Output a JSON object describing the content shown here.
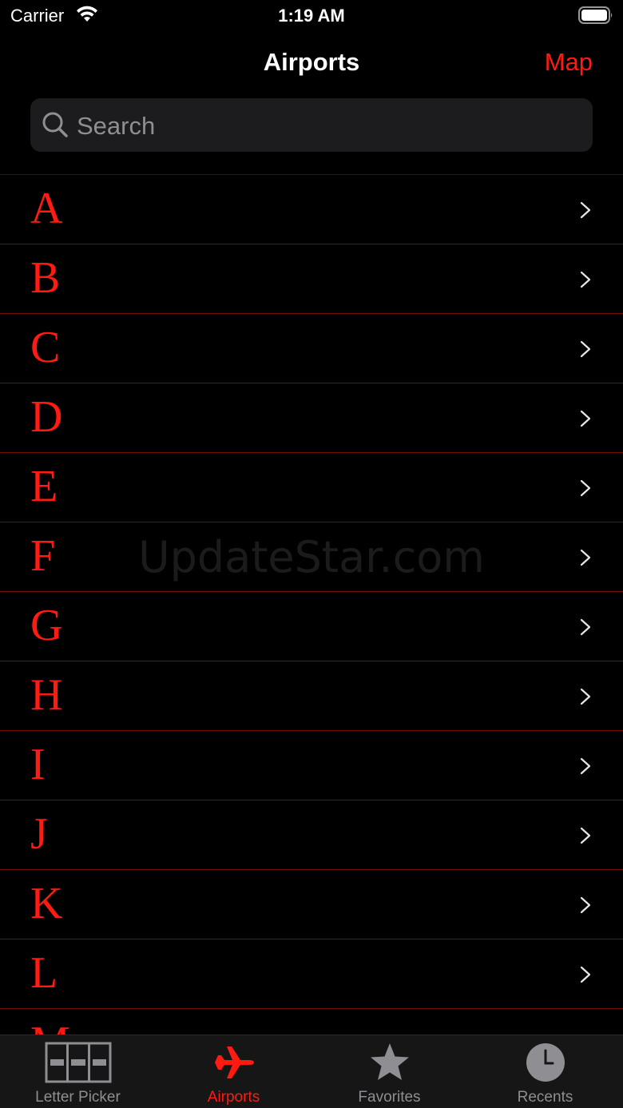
{
  "status_bar": {
    "carrier": "Carrier",
    "time": "1:19 AM"
  },
  "nav": {
    "title": "Airports",
    "right_button": "Map"
  },
  "search": {
    "placeholder": "Search",
    "value": ""
  },
  "list": {
    "letters": [
      "A",
      "B",
      "C",
      "D",
      "E",
      "F",
      "G",
      "H",
      "I",
      "J",
      "K",
      "L",
      "M"
    ]
  },
  "watermark": "UpdateStar.com",
  "tabs": [
    {
      "label": "Letter Picker",
      "icon": "letter-picker-icon",
      "active": false
    },
    {
      "label": "Airports",
      "icon": "airplane-icon",
      "active": true
    },
    {
      "label": "Favorites",
      "icon": "star-icon",
      "active": false
    },
    {
      "label": "Recents",
      "icon": "clock-icon",
      "active": false
    }
  ],
  "colors": {
    "accent": "#ff1a12",
    "background": "#000000",
    "inactive": "#8e8e93",
    "separator": "#7a0c08"
  }
}
